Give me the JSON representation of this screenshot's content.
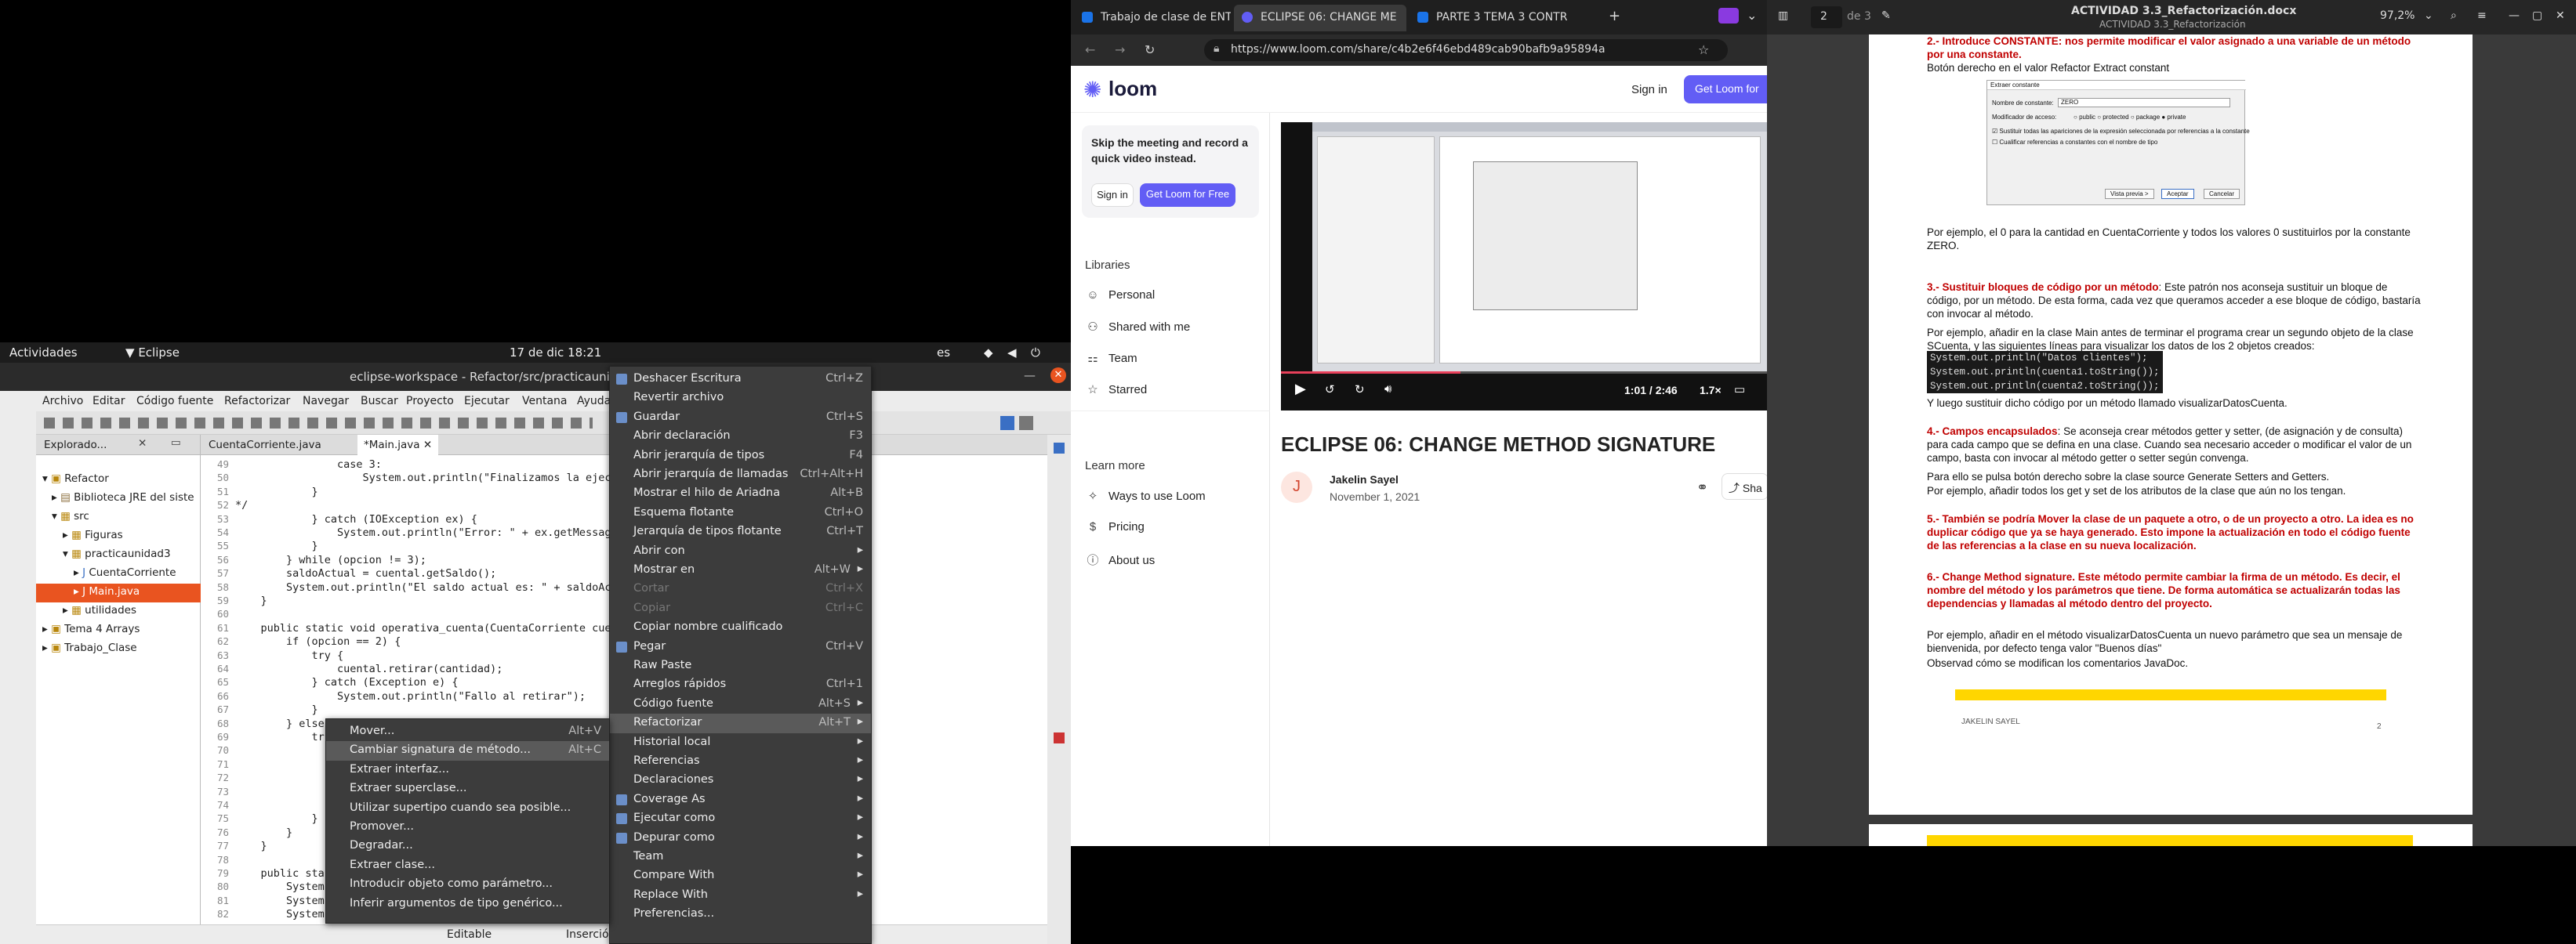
{
  "gnome": {
    "activities": "Actividades",
    "app": "Eclipse",
    "datetime": "17 de dic  18:21",
    "lang": "es"
  },
  "eclipse": {
    "title": "eclipse-workspace - Refactor/src/practicaunida",
    "menu": [
      "Archivo",
      "Editar",
      "Código fuente",
      "Refactorizar",
      "Navegar",
      "Buscar",
      "Proyecto",
      "Ejecutar",
      "Ventana",
      "Ayuda"
    ],
    "explorer_tab": "Explorado...",
    "tree": [
      "Refactor",
      "Biblioteca JRE del siste",
      "src",
      "Figuras",
      "practicaunidad3",
      "CuentaCorriente",
      "Main.java",
      "utilidades",
      "Tema 4 Arrays",
      "Trabajo_Clase"
    ],
    "editor_tabs": [
      "CuentaCorriente.java",
      "*Main.java"
    ],
    "line_numbers": [
      "49",
      "50",
      "51",
      "52",
      "53",
      "54",
      "55",
      "56",
      "57",
      "58",
      "59",
      "60",
      "61",
      "62",
      "63",
      "64",
      "65",
      "66",
      "67",
      "68",
      "69",
      "70",
      "71",
      "72",
      "73",
      "74",
      "75",
      "76",
      "77",
      "78",
      "79",
      "80",
      "81",
      "82"
    ],
    "code": [
      "                case 3:",
      "                    System.out.println(\"Finalizamos la ejecu",
      "            }",
      "*/",
      "            } catch (IOException ex) {",
      "                System.out.println(\"Error: \" + ex.getMessage",
      "            }",
      "        } while (opcion != 3);",
      "        saldoActual = cuental.getSaldo();",
      "        System.out.println(\"El saldo actual es: \" + saldoAct",
      "    }",
      "",
      "    public static void operativa_cuenta(CuentaCorriente cuen",
      "        if (opcion == 2) {",
      "            try {",
      "                cuental.retirar(cantidad);",
      "            } catch (Exception e) {",
      "                System.out.println(\"Fallo al retirar\");",
      "            }",
      "        } else",
      "            tr",
      "",
      "",
      "",
      "",
      "",
      "            }",
      "        }",
      "    }",
      "",
      "    public sta",
      "        System",
      "        System",
      "        System"
    ],
    "status": {
      "mode": "Editable",
      "insert": "Inserció"
    }
  },
  "context_menu": [
    {
      "label": "Deshacer Escritura",
      "shortcut": "Ctrl+Z",
      "icon": "undo-icon"
    },
    {
      "label": "Revertir archivo",
      "shortcut": ""
    },
    {
      "label": "Guardar",
      "shortcut": "Ctrl+S",
      "icon": "save-icon"
    },
    {
      "label": "Abrir declaración",
      "shortcut": "F3"
    },
    {
      "label": "Abrir jerarquía de tipos",
      "shortcut": "F4"
    },
    {
      "label": "Abrir jerarquía de llamadas",
      "shortcut": "Ctrl+Alt+H"
    },
    {
      "label": "Mostrar el hilo de Ariadna",
      "shortcut": "Alt+B"
    },
    {
      "label": "Esquema flotante",
      "shortcut": "Ctrl+O"
    },
    {
      "label": "Jerarquía de tipos flotante",
      "shortcut": "Ctrl+T"
    },
    {
      "label": "Abrir con",
      "shortcut": "",
      "submenu": true
    },
    {
      "label": "Mostrar en",
      "shortcut": "Alt+W",
      "submenu": true
    },
    {
      "label": "Cortar",
      "shortcut": "Ctrl+X",
      "disabled": true
    },
    {
      "label": "Copiar",
      "shortcut": "Ctrl+C",
      "disabled": true
    },
    {
      "label": "Copiar nombre cualificado",
      "shortcut": ""
    },
    {
      "label": "Pegar",
      "shortcut": "Ctrl+V",
      "icon": "paste-icon"
    },
    {
      "label": "Raw Paste",
      "shortcut": ""
    },
    {
      "label": "Arreglos rápidos",
      "shortcut": "Ctrl+1"
    },
    {
      "label": "Código fuente",
      "shortcut": "Alt+S",
      "submenu": true
    },
    {
      "label": "Refactorizar",
      "shortcut": "Alt+T",
      "submenu": true,
      "highlight": true
    },
    {
      "label": "Historial local",
      "shortcut": "",
      "submenu": true
    },
    {
      "label": "Referencias",
      "shortcut": "",
      "submenu": true
    },
    {
      "label": "Declaraciones",
      "shortcut": "",
      "submenu": true
    },
    {
      "label": "Coverage As",
      "shortcut": "",
      "submenu": true,
      "icon": "coverage-icon"
    },
    {
      "label": "Ejecutar como",
      "shortcut": "",
      "submenu": true,
      "icon": "run-icon"
    },
    {
      "label": "Depurar como",
      "shortcut": "",
      "submenu": true,
      "icon": "debug-icon"
    },
    {
      "label": "Team",
      "shortcut": "",
      "submenu": true
    },
    {
      "label": "Compare With",
      "shortcut": "",
      "submenu": true
    },
    {
      "label": "Replace With",
      "shortcut": "",
      "submenu": true
    },
    {
      "label": "Preferencias...",
      "shortcut": ""
    }
  ],
  "refactor_submenu": [
    {
      "label": "Mover...",
      "shortcut": "Alt+V"
    },
    {
      "label": "Cambiar signatura de método...",
      "shortcut": "Alt+C",
      "highlight": true
    },
    {
      "label": "Extraer interfaz...",
      "shortcut": ""
    },
    {
      "label": "Extraer superclase...",
      "shortcut": ""
    },
    {
      "label": "Utilizar supertipo cuando sea posible...",
      "shortcut": ""
    },
    {
      "label": "Promover...",
      "shortcut": ""
    },
    {
      "label": "Degradar...",
      "shortcut": ""
    },
    {
      "label": "Extraer clase...",
      "shortcut": ""
    },
    {
      "label": "Introducir objeto como parámetro...",
      "shortcut": ""
    },
    {
      "label": "Inferir argumentos de tipo genérico...",
      "shortcut": ""
    }
  ],
  "browser": {
    "tabs": [
      "Trabajo de clase de ENTO",
      "ECLIPSE 06: CHANGE ME",
      "PARTE 3 TEMA 3 CONTR"
    ],
    "url": "https://www.loom.com/share/c4b2e6f46ebd489cab90bafb9a95894a",
    "loom": {
      "brand": "loom",
      "signin": "Sign in",
      "cta": "Get Loom for",
      "promo": "Skip the meeting and record a quick video instead.",
      "promo_signin": "Sign in",
      "promo_cta": "Get Loom for Free",
      "libraries": "Libraries",
      "nav": [
        "Personal",
        "Shared with me",
        "Team",
        "Starred"
      ],
      "learn": "Learn more",
      "learn_nav": [
        "Ways to use Loom",
        "Pricing",
        "About us"
      ],
      "video_time": "1:01 / 2:46",
      "speed": "1.7×",
      "video_title": "ECLIPSE 06: CHANGE METHOD SIGNATURE",
      "author": "Jakelin Sayel",
      "author_initial": "J",
      "date": "November 1, 2021",
      "share": "Sha",
      "progress": 0.37
    }
  },
  "doc": {
    "title": "ACTIVIDAD 3.3_Refactorización.docx",
    "subtitle": "ACTIVIDAD 3.3_Refactorización",
    "page": "2",
    "page_of": "de 3",
    "zoom": "97,2%",
    "line_top1": "2.- Introduce CONSTANTE: nos permite modificar el valor asignado a una variable de un método por una constante.",
    "line_top2": "Botón derecho en el valor    Refactor     Extract constant",
    "dialog_title": "Extraer constante",
    "dialog_name_label": "Nombre de constante:",
    "dialog_name_value": "ZERO",
    "dialog_access": "Modificador de acceso:",
    "dialog_opts": [
      "public",
      "protected",
      "package",
      "private"
    ],
    "dialog_chk1": "Sustituir todas las apariciones de la expresión seleccionada por referencias a la constante",
    "dialog_chk2": "Cualificar referencias a constantes con el nombre de tipo",
    "dialog_btns": [
      "Vista previa >",
      "Aceptar",
      "Cancelar"
    ],
    "para1": "Por ejemplo, el 0 para la cantidad en CuentaCorriente y todos los valores 0 sustituirlos por la constante ZERO.",
    "h3": "3.- Sustituir bloques de código por un método",
    "p3": ": Este patrón nos aconseja sustituir un bloque de código, por un método. De esta forma, cada vez que queramos acceder a ese bloque de código, bastaría con invocar al método.",
    "p3b": "Por ejemplo, añadir en la clase Main antes de terminar el programa crear un segundo objeto de la clase SCuenta, y las siguientes líneas para visualizar los datos de los 2 objetos creados:",
    "code3": [
      "System.out.println(\"Datos clientes\");",
      "System.out.println(cuenta1.toString());",
      "System.out.println(cuenta2.toString());"
    ],
    "p3c": "Y luego sustituir dicho código por un método llamado visualizarDatosCuenta.",
    "h4": "4.- Campos encapsulados",
    "p4": ": Se aconseja crear métodos getter y setter, (de asignación y de consulta) para cada campo que se defina en una clase. Cuando sea necesario acceder o modificar el valor de un campo, basta con invocar al método getter o setter según convenga.",
    "p4b": "Para ello se pulsa botón derecho sobre la clase     source      Generate Setters and Getters.",
    "p4c": "Por ejemplo, añadir todos los get y set de los atributos de la clase que aún no los tengan.",
    "h5": "5.- También se podría Mover la clase de un paquete a otro, o de un proyecto a otro. La idea es no duplicar código que ya se haya generado. Esto impone la actualización en todo el código fuente de las referencias a la clase en su nueva localización.",
    "h6": "6.- Change Method signature. Este método permite cambiar la firma de un método. Es decir, el nombre del método y los parámetros que tiene. De forma automática se actualizarán todas las dependencias y llamadas al método dentro del proyecto.",
    "p6": "Por ejemplo, añadir en el método visualizarDatosCuenta un nuevo parámetro que sea un mensaje de bienvenida, por defecto tenga valor \"Buenos días\"",
    "p6b": "Observad cómo se modifican los comentarios JavaDoc.",
    "footer_author": "JAKELIN SAYEL",
    "footer_page": "2"
  },
  "colors": {
    "accent": "#625df5",
    "eclipse_hl": "#e95420",
    "doc_bar": "#ffd600"
  }
}
